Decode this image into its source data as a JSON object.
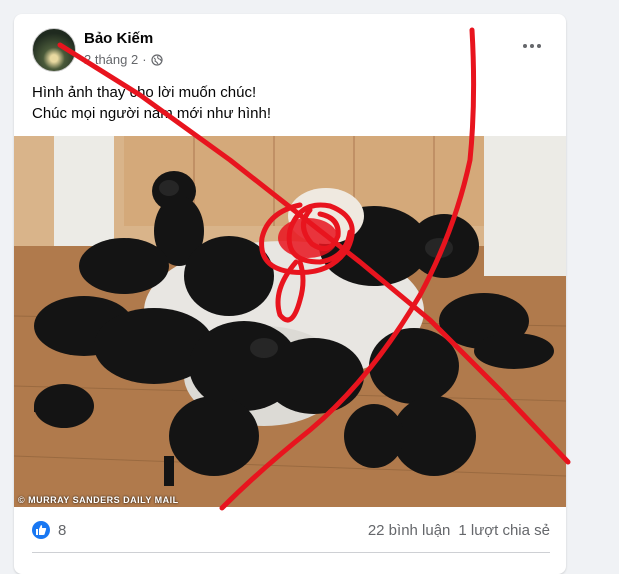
{
  "post": {
    "author": "Bảo Kiếm",
    "date": "2 tháng 2",
    "separator": "·",
    "text_line1": "Hình ảnh thay cho lời muốn chúc!",
    "text_line2": "Chúc mọi người năm mới như hình!",
    "photo_watermark": "© MURRAY SANDERS DAILY MAIL",
    "reaction_count": "8",
    "comments": "22 bình luận",
    "shares": "1 lượt chia sẻ"
  },
  "icons": {
    "more": "ellipsis-icon",
    "privacy": "globe-icon",
    "reaction": "like-icon"
  },
  "colors": {
    "like_blue": "#1877f2",
    "annotation_red": "#e8141e"
  }
}
